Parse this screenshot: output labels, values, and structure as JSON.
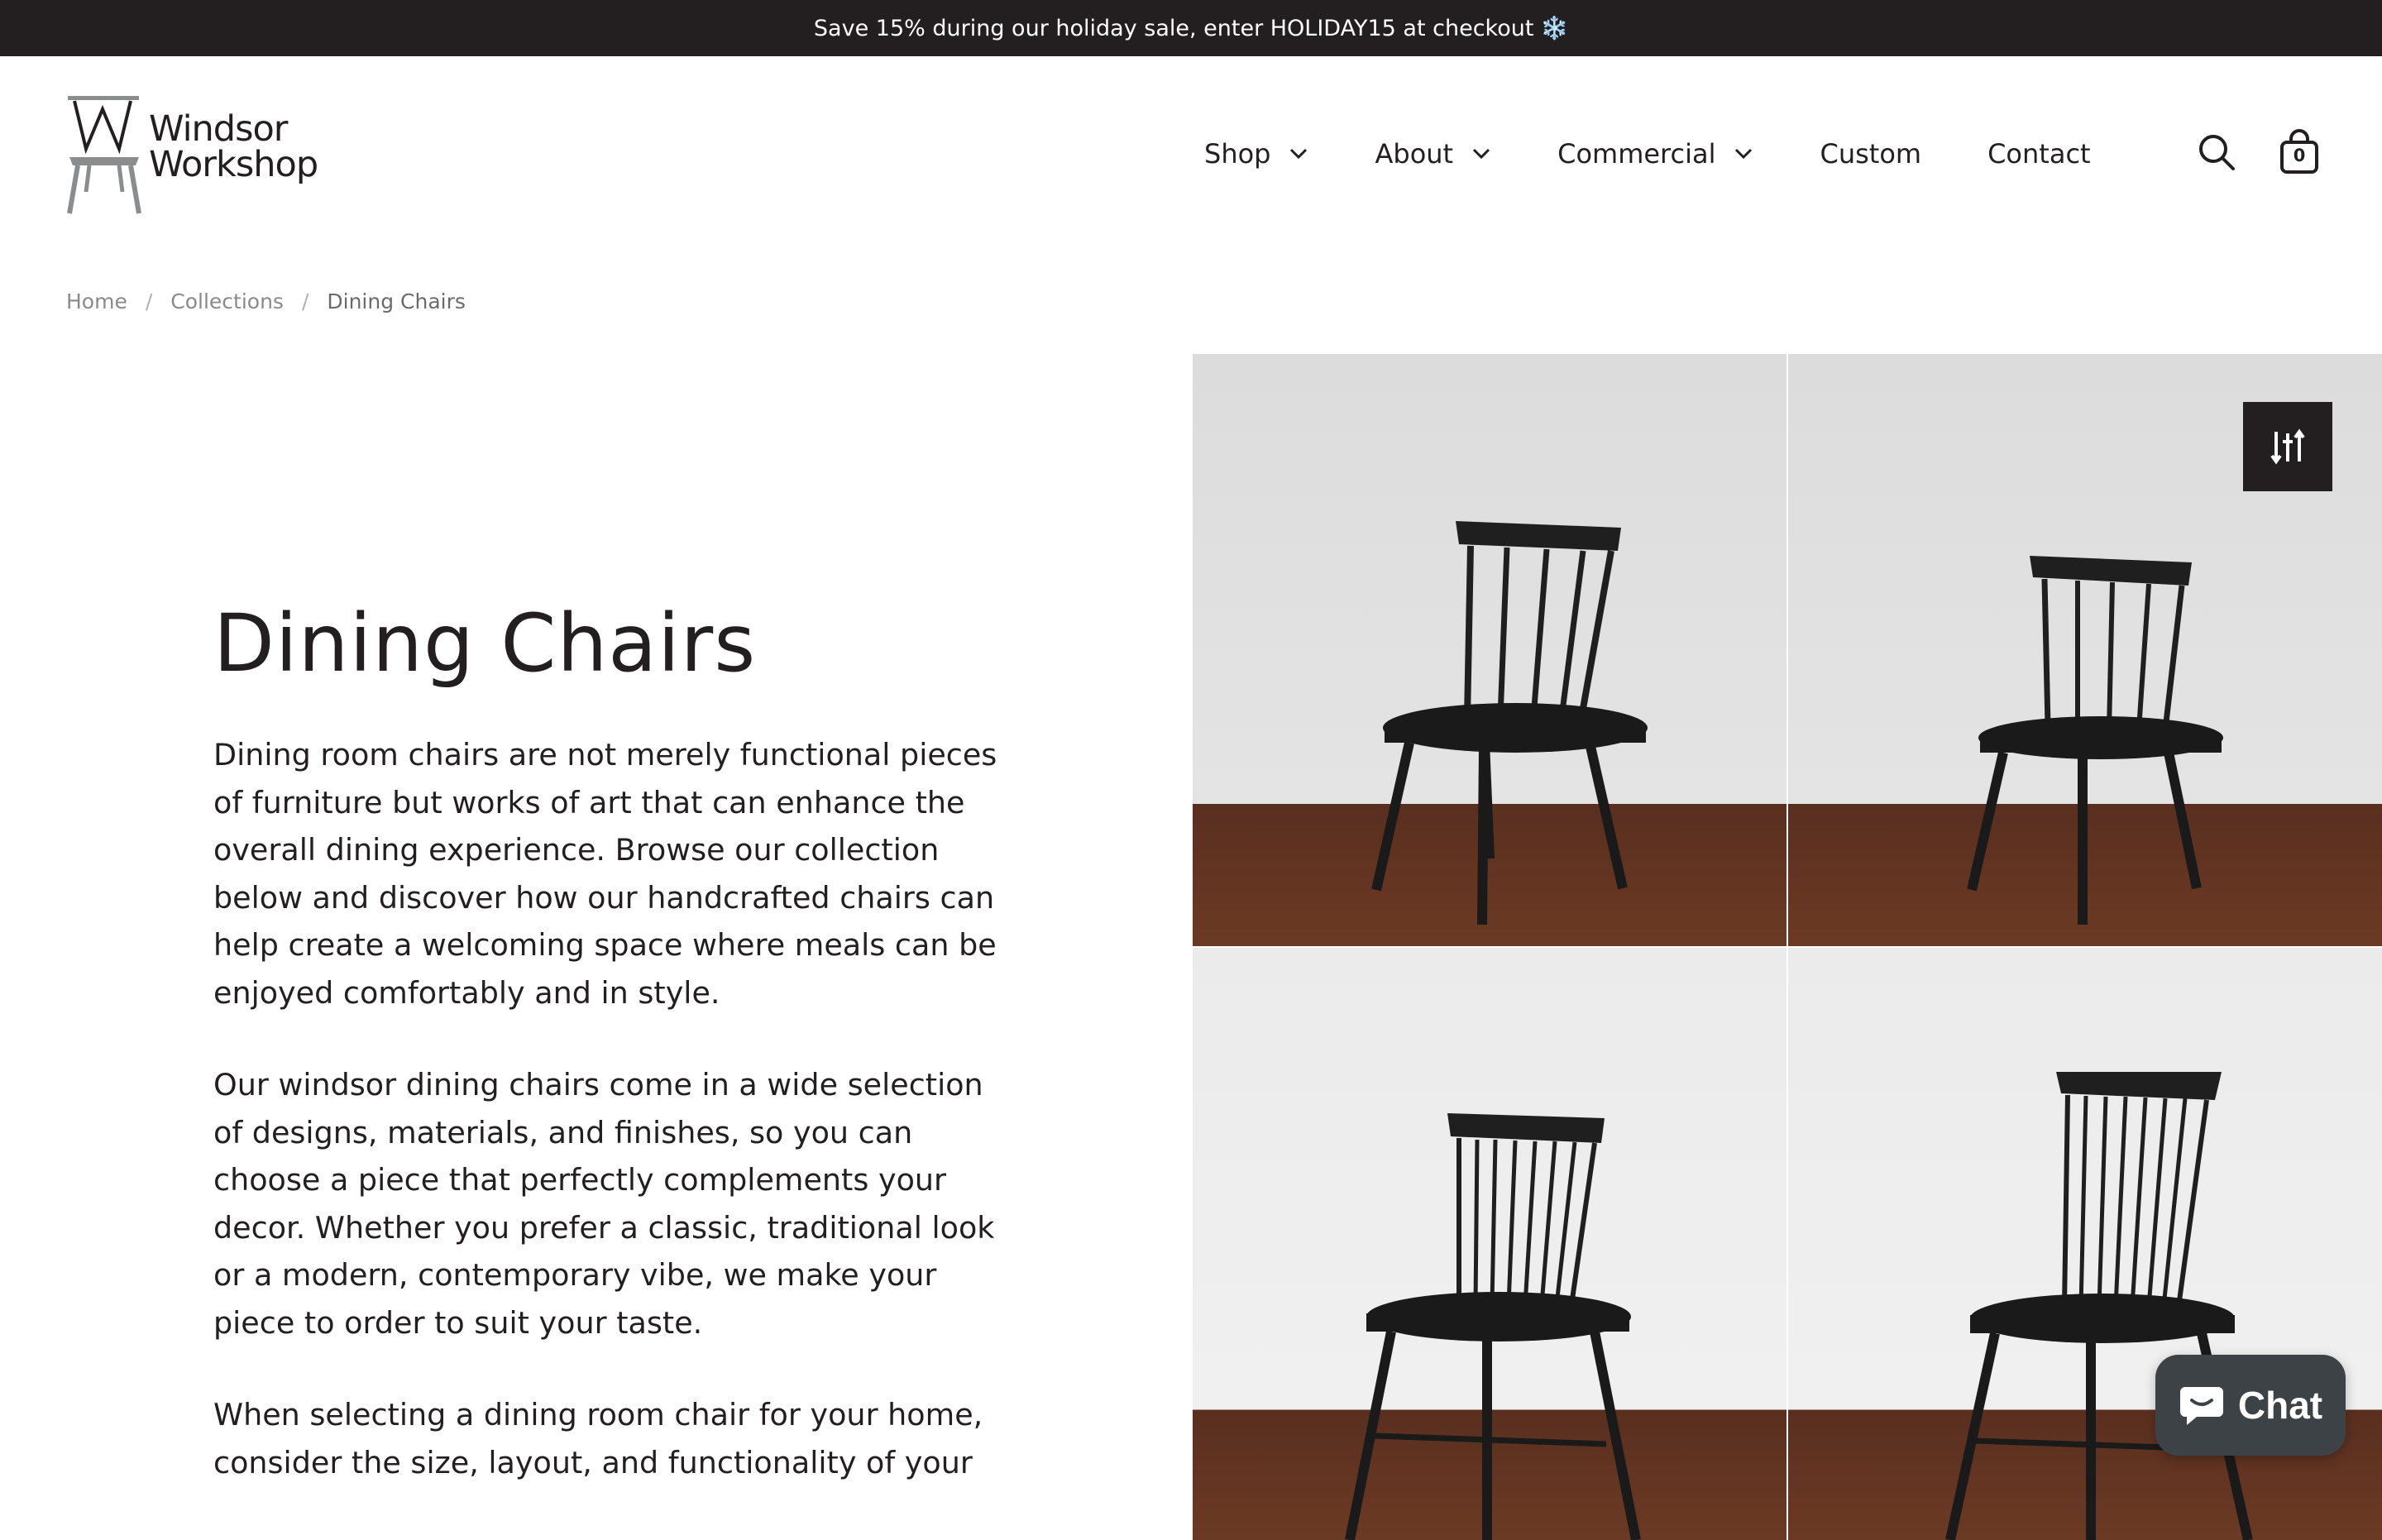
{
  "announcement": {
    "text": "Save 15% during our holiday sale, enter HOLIDAY15 at checkout",
    "icon": "snowflake-icon",
    "emoji": "❄️"
  },
  "brand": {
    "line1": "Windsor",
    "line2": "Workshop"
  },
  "nav": {
    "items": [
      {
        "label": "Shop",
        "has_dropdown": true
      },
      {
        "label": "About",
        "has_dropdown": true
      },
      {
        "label": "Commercial",
        "has_dropdown": true
      },
      {
        "label": "Custom",
        "has_dropdown": false
      },
      {
        "label": "Contact",
        "has_dropdown": false
      }
    ]
  },
  "header_icons": {
    "search": "search-icon",
    "cart": "shopping-bag-icon",
    "cart_count": "0"
  },
  "breadcrumb": {
    "items": [
      "Home",
      "Collections"
    ],
    "current": "Dining Chairs",
    "separator": "/"
  },
  "collection": {
    "title": "Dining Chairs",
    "paragraphs": [
      "Dining room chairs are not merely functional pieces of furniture but works of art that can enhance the overall dining experience. Browse our collection below and discover how our handcrafted chairs can help create a welcoming space where meals can be enjoyed comfortably and in style.",
      "Our windsor dining chairs come in a wide selection of designs, materials, and finishes, so you can choose a piece that perfectly complements your decor. Whether you prefer a classic, traditional look or a modern, contemporary vibe, we make your piece to order to suit your taste.",
      "When selecting a dining room chair for your home, consider the size, layout, and functionality of your"
    ]
  },
  "products": {
    "count": 4,
    "image_icon": "chair-image"
  },
  "filter": {
    "icon": "filter-sliders-icon"
  },
  "chat": {
    "label": "Chat",
    "icon": "chat-bubble-icon"
  },
  "colors": {
    "dark": "#231f20",
    "chat_bg": "#3c4246",
    "breadcrumb": "#8a8a8a"
  }
}
